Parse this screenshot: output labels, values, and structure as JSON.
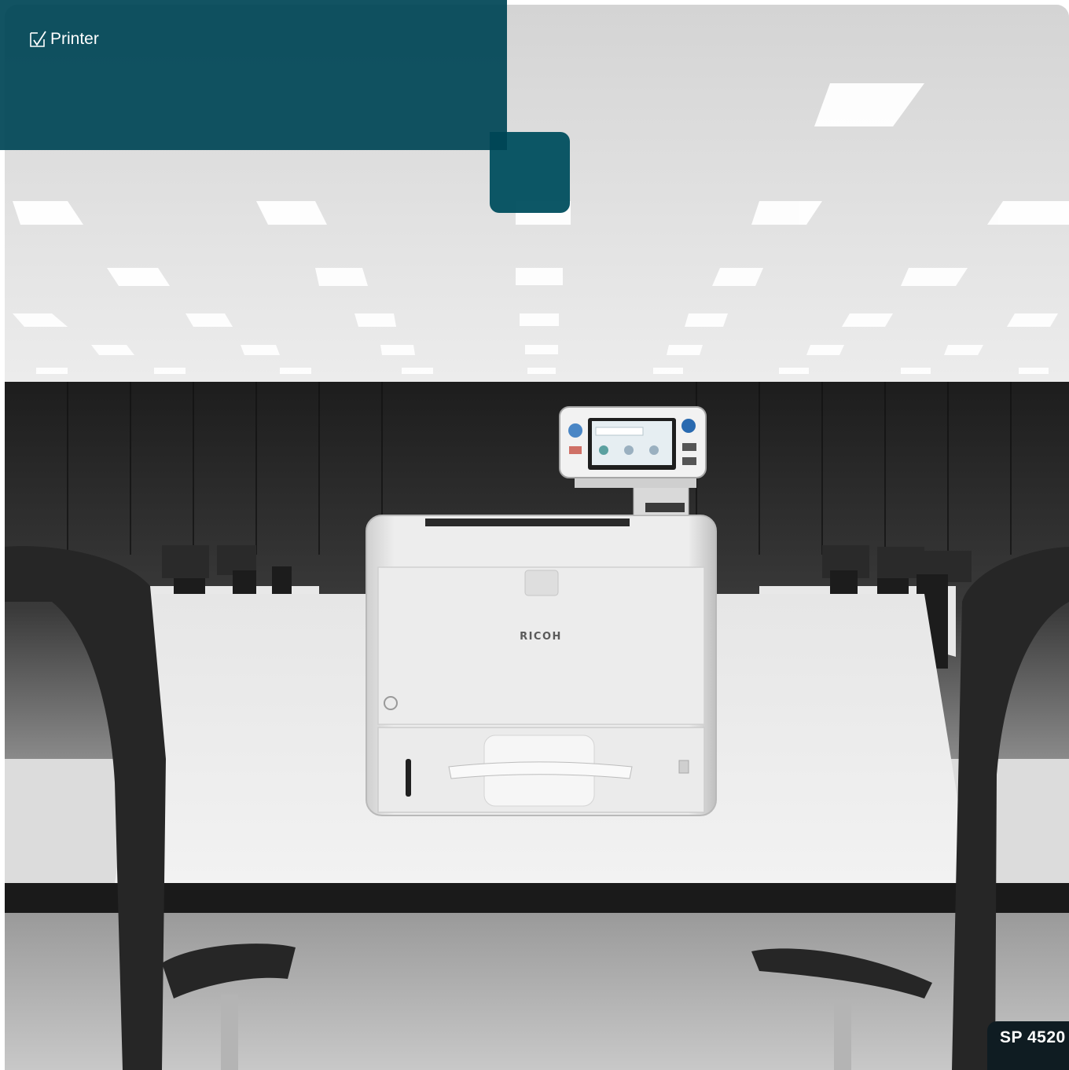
{
  "header": {
    "title": "Printer",
    "icon": "checkbox-tick-icon",
    "band_color": "#004656"
  },
  "product": {
    "brand": "RICOH",
    "model": "SP 4520"
  },
  "scene": {
    "description_icon": "printer-photo"
  }
}
